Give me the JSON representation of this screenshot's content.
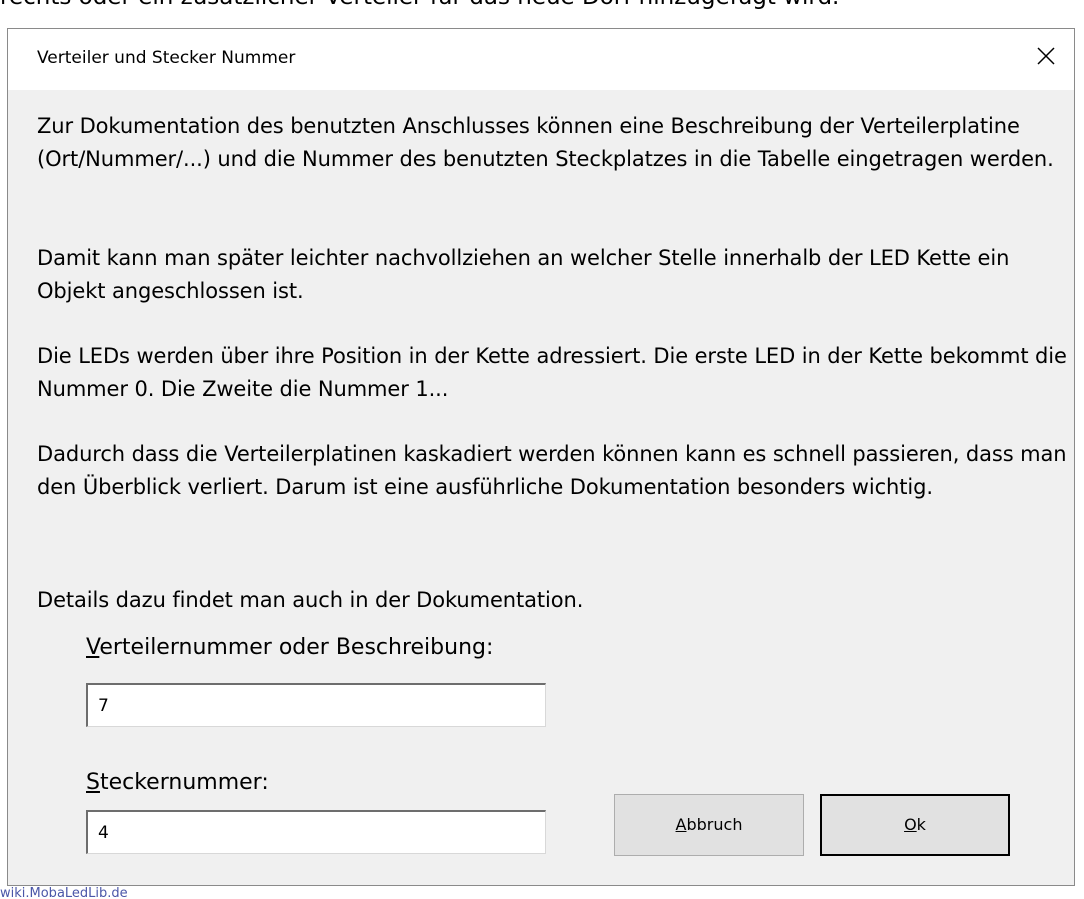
{
  "background": {
    "text": "rechts oder ein zusätzlicher Verteiler für das neue Dorf hinzugefügt wird."
  },
  "dialog": {
    "title": "Verteiler und Stecker Nummer",
    "close_glyph": "×",
    "paragraphs": [
      "Zur Dokumentation des benutzten Anschlusses können eine Beschreibung der Verteilerplatine (Ort/Nummer/...) und die Nummer des benutzten Steckplatzes in die Tabelle eingetragen werden.",
      "Damit kann man später leichter nachvollziehen an welcher Stelle innerhalb der LED Kette ein Objekt angeschlossen ist.",
      "Die LEDs werden über ihre Position in der Kette adressiert. Die erste LED in der Kette bekommt die Nummer 0. Die Zweite die Nummer 1...",
      "Dadurch dass die Verteilerplatinen kaskadiert werden können kann es schnell passieren, dass man den Überblick verliert. Darum ist eine ausführliche Dokumentation besonders wichtig.",
      "Details dazu findet man auch in der Dokumentation."
    ],
    "verteiler_label": {
      "mnemonic": "V",
      "rest": "erteilernummer oder Beschreibung:"
    },
    "verteiler_value": "7",
    "stecker_label": {
      "mnemonic": "S",
      "rest": "teckernummer:"
    },
    "stecker_value": "4",
    "cancel_button": {
      "mnemonic": "A",
      "rest": "bbruch"
    },
    "ok_button": {
      "mnemonic": "O",
      "rest": "k"
    }
  },
  "footer": {
    "link_text": "wiki.MobaLedLib.de"
  },
  "colors": {
    "dialog_bg": "#f0f0f0",
    "titlebar_bg": "#ffffff",
    "button_bg": "#e1e1e1",
    "link": "#4a56a8"
  },
  "icons": {
    "close": "close-icon"
  }
}
